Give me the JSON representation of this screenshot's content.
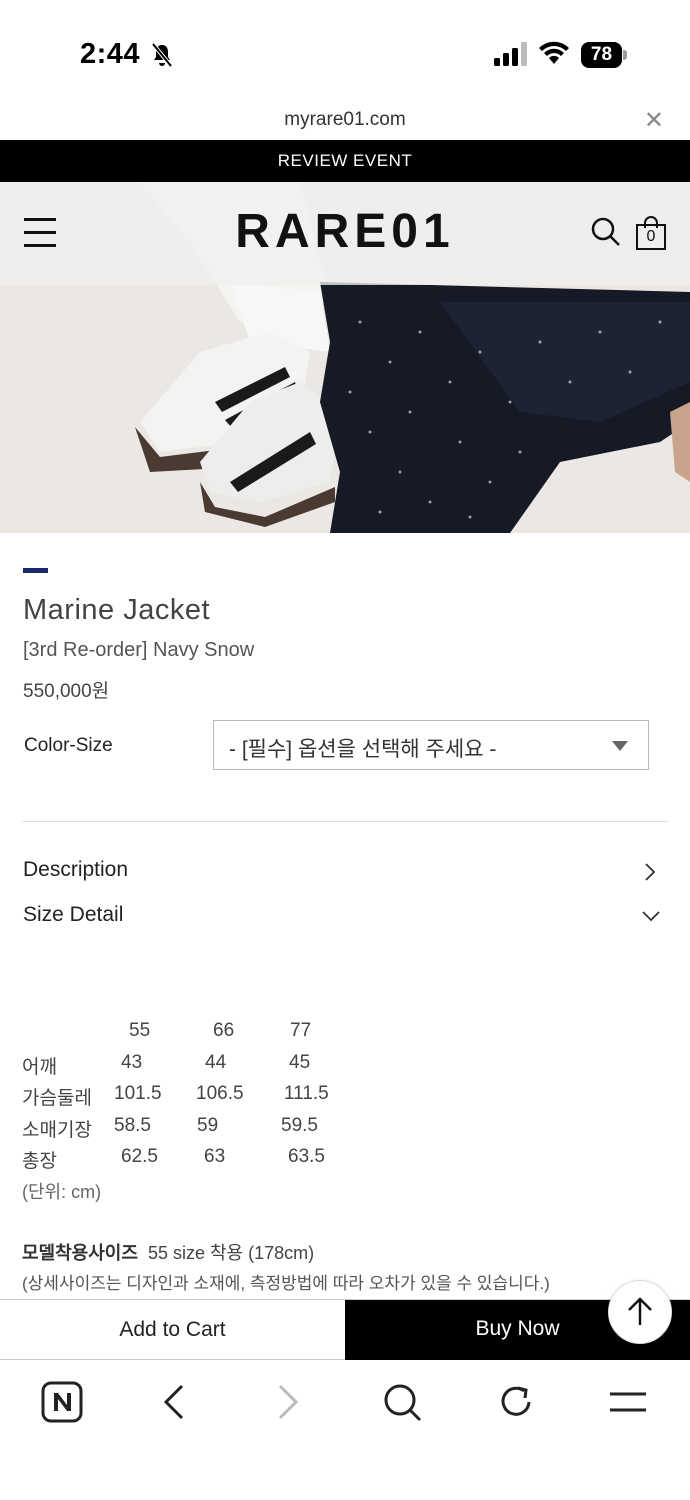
{
  "status_bar": {
    "time": "2:44",
    "battery": "78"
  },
  "browser": {
    "url": "myrare01.com"
  },
  "banner": {
    "text": "REVIEW EVENT"
  },
  "header": {
    "logo": "RARE01",
    "cart_count": "0"
  },
  "product": {
    "name": "Marine Jacket",
    "subtitle": "[3rd Re-order] Navy Snow",
    "price": "550,000원",
    "option_label": "Color-Size",
    "option_placeholder": "- [필수] 옵션을 선택해 주세요 -"
  },
  "sections": {
    "description": "Description",
    "size_detail": "Size Detail"
  },
  "size_table": {
    "headers": [
      "",
      "55",
      "66",
      "77"
    ],
    "rows": [
      [
        "어깨",
        "43",
        "44",
        "45"
      ],
      [
        "가슴둘레",
        "101.5",
        "106.5",
        "111.5"
      ],
      [
        "소매기장",
        "58.5",
        "59",
        "59.5"
      ],
      [
        "총장",
        "62.5",
        "63",
        "63.5"
      ]
    ],
    "unit": "(단위: cm)"
  },
  "model_info": {
    "label": "모델착용사이즈",
    "value": "55 size 착용 (178cm)",
    "note": "(상세사이즈는 디자인과 소재에, 측정방법에 따라 오차가 있을 수 있습니다.)"
  },
  "actions": {
    "add_to_cart": "Add to Cart",
    "buy_now": "Buy Now"
  },
  "colors": {
    "accent": "#1b2a6b",
    "banner_bg": "#000000"
  }
}
